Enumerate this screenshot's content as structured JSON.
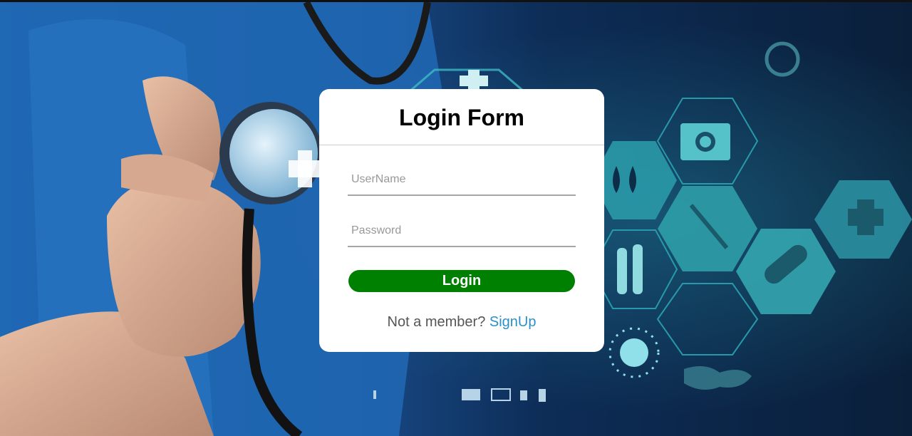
{
  "corner_mark": ">",
  "login": {
    "title": "Login Form",
    "username_placeholder": "UserName",
    "password_placeholder": "Password",
    "username_value": "",
    "password_value": "",
    "submit_label": "Login",
    "member_prompt": "Not a member?",
    "signup_label": "SignUp"
  },
  "colors": {
    "button": "#008000",
    "link": "#2d8fc8",
    "card": "#ffffff"
  },
  "background": {
    "subject": "medical-professional-with-stethoscope",
    "icons": [
      "medical-kit-icon",
      "drops-icon",
      "syringe-icon",
      "test-tubes-icon",
      "pill-icon",
      "medical-cross-icon",
      "virus-icon",
      "world-map-icon"
    ]
  }
}
